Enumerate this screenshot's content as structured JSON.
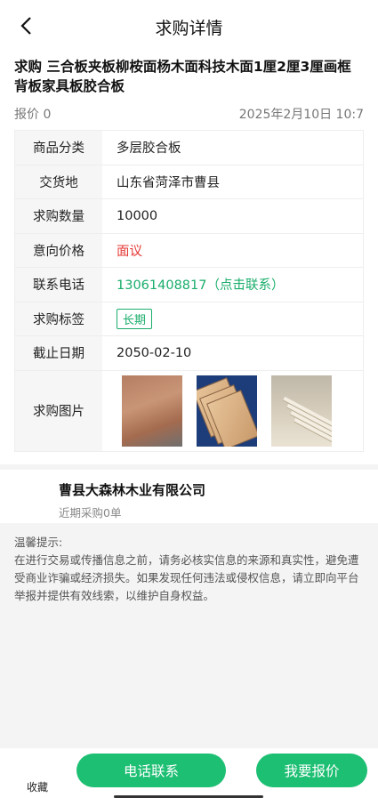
{
  "header": {
    "title": "求购详情"
  },
  "product": {
    "title": "求购 三合板夹板柳桉面杨木面科技木面1厘2厘3厘画框背板家具板胶合板",
    "quote_count": "报价 0",
    "date": "2025年2月10日 10:7"
  },
  "details": {
    "category_label": "商品分类",
    "category_value": "多层胶合板",
    "place_label": "交货地",
    "place_value": "山东省菏泽市曹县",
    "qty_label": "求购数量",
    "qty_value": "10000",
    "price_label": "意向价格",
    "price_value": "面议",
    "phone_label": "联系电话",
    "phone_value": "13061408817（点击联系）",
    "tag_label": "求购标签",
    "tag_value": "长期",
    "deadline_label": "截止日期",
    "deadline_value": "2050-02-10",
    "images_label": "求购图片"
  },
  "company": {
    "name": "曹县大森林木业有限公司",
    "recent": "近期采购0单"
  },
  "tips": {
    "title": "温馨提示:",
    "body": "在进行交易或传播信息之前，请务必核实信息的来源和真实性，避免遭受商业诈骗或经济损失。如果发现任何违法或侵权信息，请立即向平台举报并提供有效线索，以维护自身权益。"
  },
  "bottom": {
    "favorite_label": "收藏",
    "call_label": "电话联系",
    "quote_label": "我要报价"
  },
  "colors": {
    "accent": "#1dbf73",
    "price": "#e53935",
    "phone": "#1aad6b"
  }
}
